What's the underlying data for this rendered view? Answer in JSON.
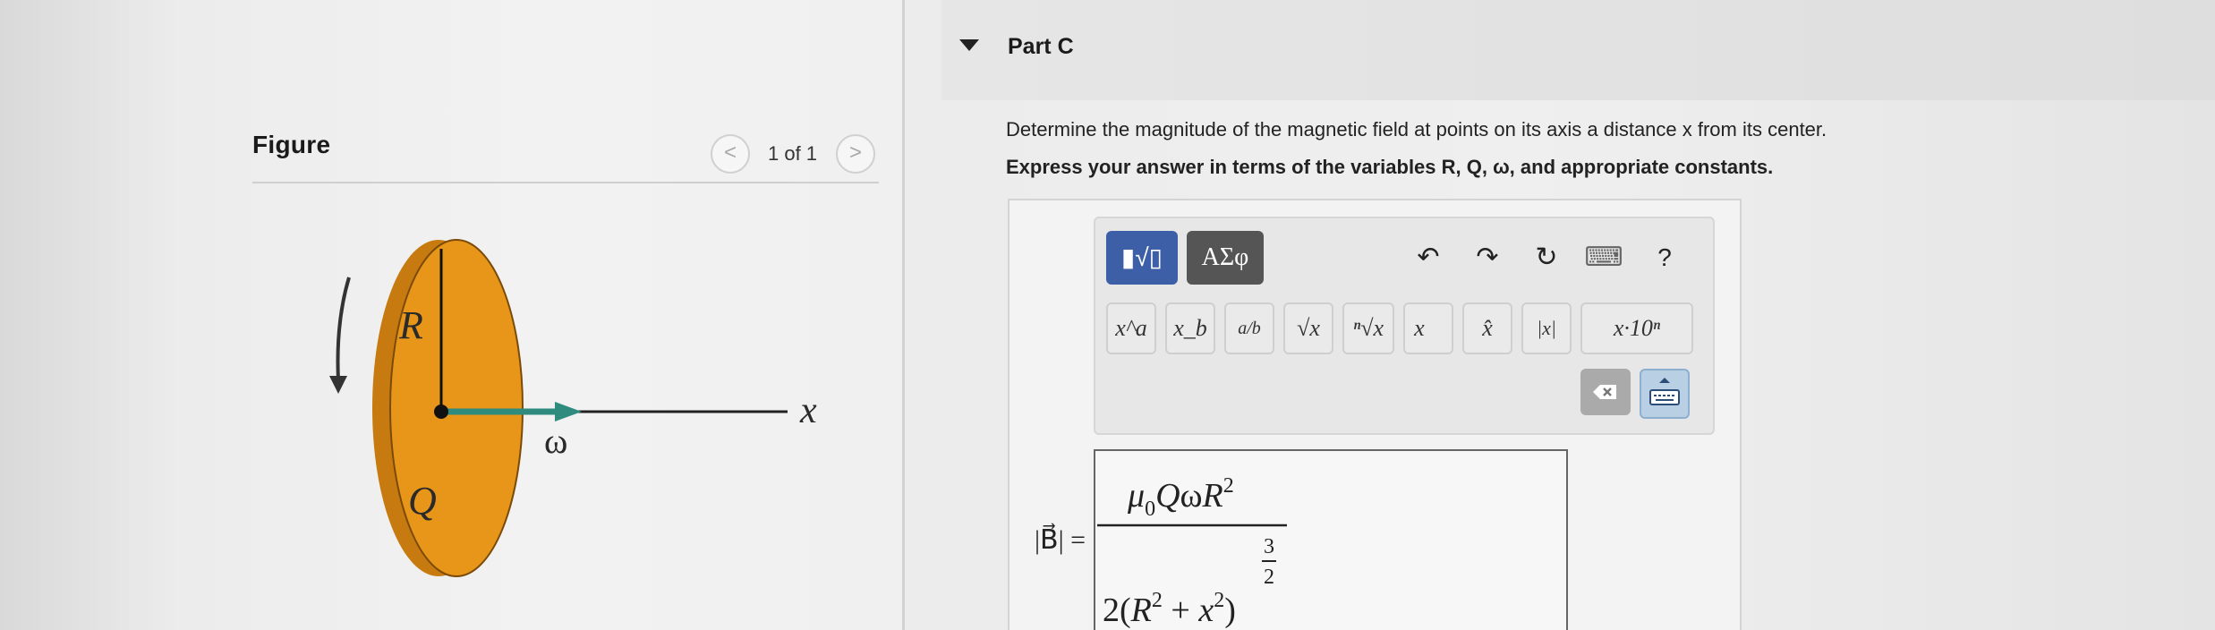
{
  "figure": {
    "title": "Figure",
    "pager_text": "1 of 1",
    "prev_glyph": "<",
    "next_glyph": ">",
    "labels": {
      "radius": "R",
      "charge": "Q",
      "omega": "ω",
      "axis": "x"
    }
  },
  "part": {
    "title": "Part C",
    "question": "Determine the magnitude of the magnetic field at points on its axis a distance x from its center.",
    "instruction": "Express your answer in terms of the variables R, Q, ω, and appropriate constants."
  },
  "toolbar": {
    "template_mode": "▮√▯",
    "greek_mode": "ΑΣφ",
    "undo": "↶",
    "redo": "↷",
    "reset": "↻",
    "keyboard": "⌨",
    "help": "?",
    "templates": [
      "x^a",
      "x_b",
      "a/b",
      "√x",
      "ⁿ√x",
      "x⃗",
      "x̂",
      "|x|",
      "x·10ⁿ"
    ]
  },
  "answer": {
    "lhs": "|B⃗| =",
    "numerator": "μ0QωR2",
    "denominator": "2(R2+x2)3/2"
  },
  "colors": {
    "disk": "#e8961a",
    "disk_edge": "#c77a10",
    "arrow": "#2e8b7e",
    "mode_active": "#3d5fa8",
    "mode_dark": "#555555"
  }
}
